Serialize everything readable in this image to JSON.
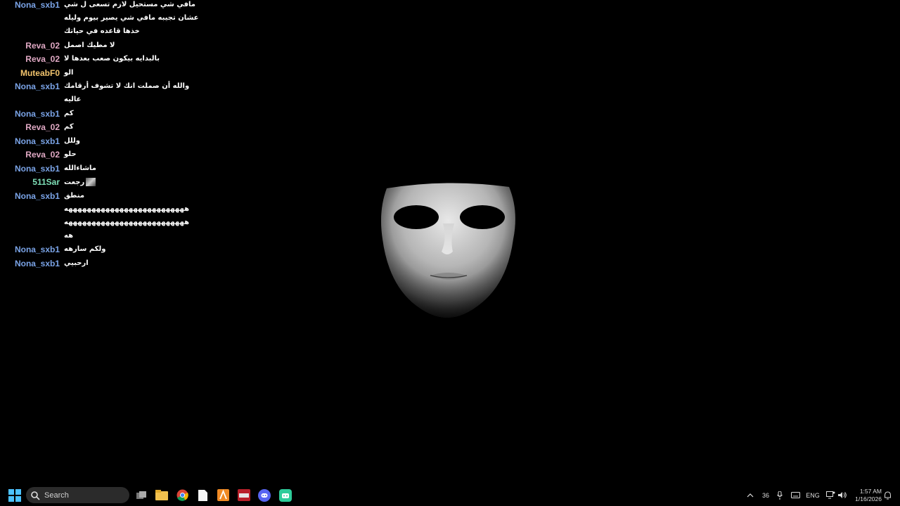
{
  "chat": {
    "messages": [
      {
        "user": "Nona_sxb1",
        "color": "#7aa3e6",
        "lines": [
          "مافي شي مستحيل لازم تسعى ل شي",
          "عشان تجيبه مافي شي يصير بيوم وليله",
          "خذها قاعده في حياتك"
        ]
      },
      {
        "user": "Reva_02",
        "color": "#e0a9c4",
        "lines": [
          "لا مطيك اصمل"
        ]
      },
      {
        "user": "Reva_02",
        "color": "#e0a9c4",
        "lines": [
          "بالبدايه بيكون صعب بعدها لا"
        ]
      },
      {
        "user": "MuteabF0",
        "color": "#f2c46d",
        "lines": [
          "الو"
        ]
      },
      {
        "user": "Nona_sxb1",
        "color": "#7aa3e6",
        "lines": [
          "والله أن صملت انك لا تشوف أرقامك",
          "عاليه"
        ]
      },
      {
        "user": "Nona_sxb1",
        "color": "#7aa3e6",
        "lines": [
          "كم"
        ]
      },
      {
        "user": "Reva_02",
        "color": "#e0a9c4",
        "lines": [
          "كم"
        ]
      },
      {
        "user": "Nona_sxb1",
        "color": "#7aa3e6",
        "lines": [
          "وللل"
        ]
      },
      {
        "user": "Reva_02",
        "color": "#e0a9c4",
        "lines": [
          "حلو"
        ]
      },
      {
        "user": "Nona_sxb1",
        "color": "#7aa3e6",
        "lines": [
          "ماشاءالله"
        ]
      },
      {
        "user": "511Sar",
        "color": "#7ee0b8",
        "lines": [
          "رجعت"
        ],
        "emote": "emote"
      },
      {
        "user": "Nona_sxb1",
        "color": "#7aa3e6",
        "lines": [
          "منطق",
          "ههههههههههههههههههههههههههه",
          "ههههههههههههههههههههههههههه",
          "هه"
        ]
      },
      {
        "user": "Nona_sxb1",
        "color": "#7aa3e6",
        "lines": [
          "ولكم سارهه"
        ]
      },
      {
        "user": "Nona_sxb1",
        "color": "#7aa3e6",
        "lines": [
          "ارحبيي"
        ]
      }
    ]
  },
  "taskbar": {
    "search_label": "Search",
    "apps": [
      "task-view-icon",
      "file-explorer-icon",
      "chrome-icon",
      "notepad-icon",
      "app-icon",
      "video-app-icon",
      "discord-icon",
      "android-app-icon"
    ],
    "tray": {
      "temp": "36",
      "language": "ENG",
      "time": "1:57 AM",
      "date": "1/16/2026"
    }
  }
}
